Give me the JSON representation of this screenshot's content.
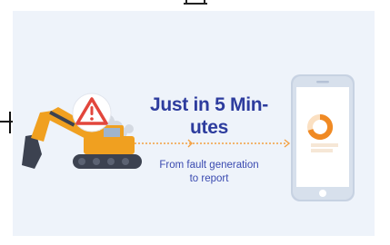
{
  "headline": {
    "line1": "Just in 5 Min-",
    "line2": "utes"
  },
  "subline": {
    "line1": "From fault generation",
    "line2": "to report"
  },
  "icons": {
    "excavator": "excavator-icon",
    "warning": "warning-triangle-icon",
    "phone": "smartphone-icon",
    "donut": "donut-chart-icon",
    "arrow": "dotted-arrow-icon"
  },
  "colors": {
    "background_panel": "#eef3fa",
    "excavator_orange": "#f0a020",
    "excavator_dark": "#3c4250",
    "warning_red": "#e2463c",
    "headline_blue": "#2d3c9e",
    "arrow_orange": "#f4a040",
    "phone_gray": "#c7d2e2",
    "donut_orange": "#f08a24"
  }
}
